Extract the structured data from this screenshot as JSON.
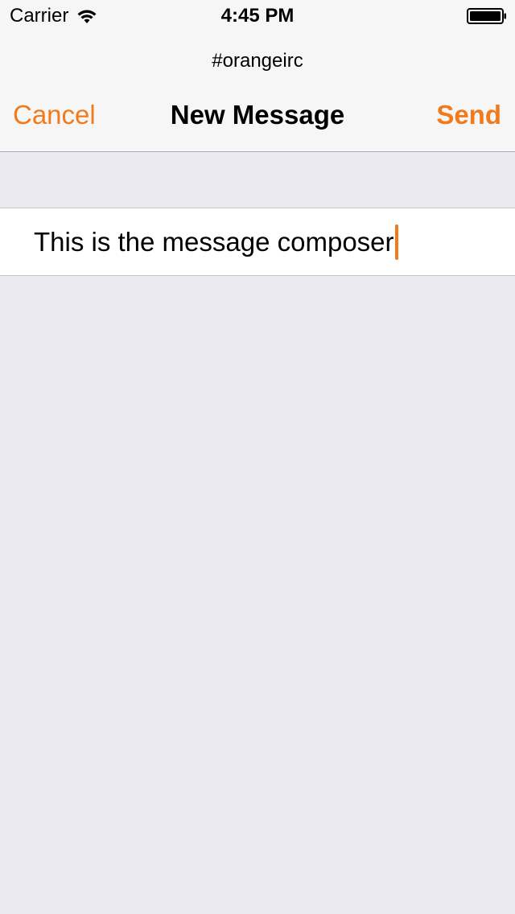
{
  "status_bar": {
    "carrier": "Carrier",
    "time": "4:45 PM",
    "icons": [
      "wifi-icon",
      "battery-icon"
    ]
  },
  "nav": {
    "prompt": "#orangeirc",
    "title": "New Message",
    "cancel_label": "Cancel",
    "send_label": "Send"
  },
  "composer": {
    "value": "This is the message composer"
  },
  "colors": {
    "accent": "#f27a1a",
    "background": "#ebeaf0",
    "bar": "#f6f6f7"
  }
}
